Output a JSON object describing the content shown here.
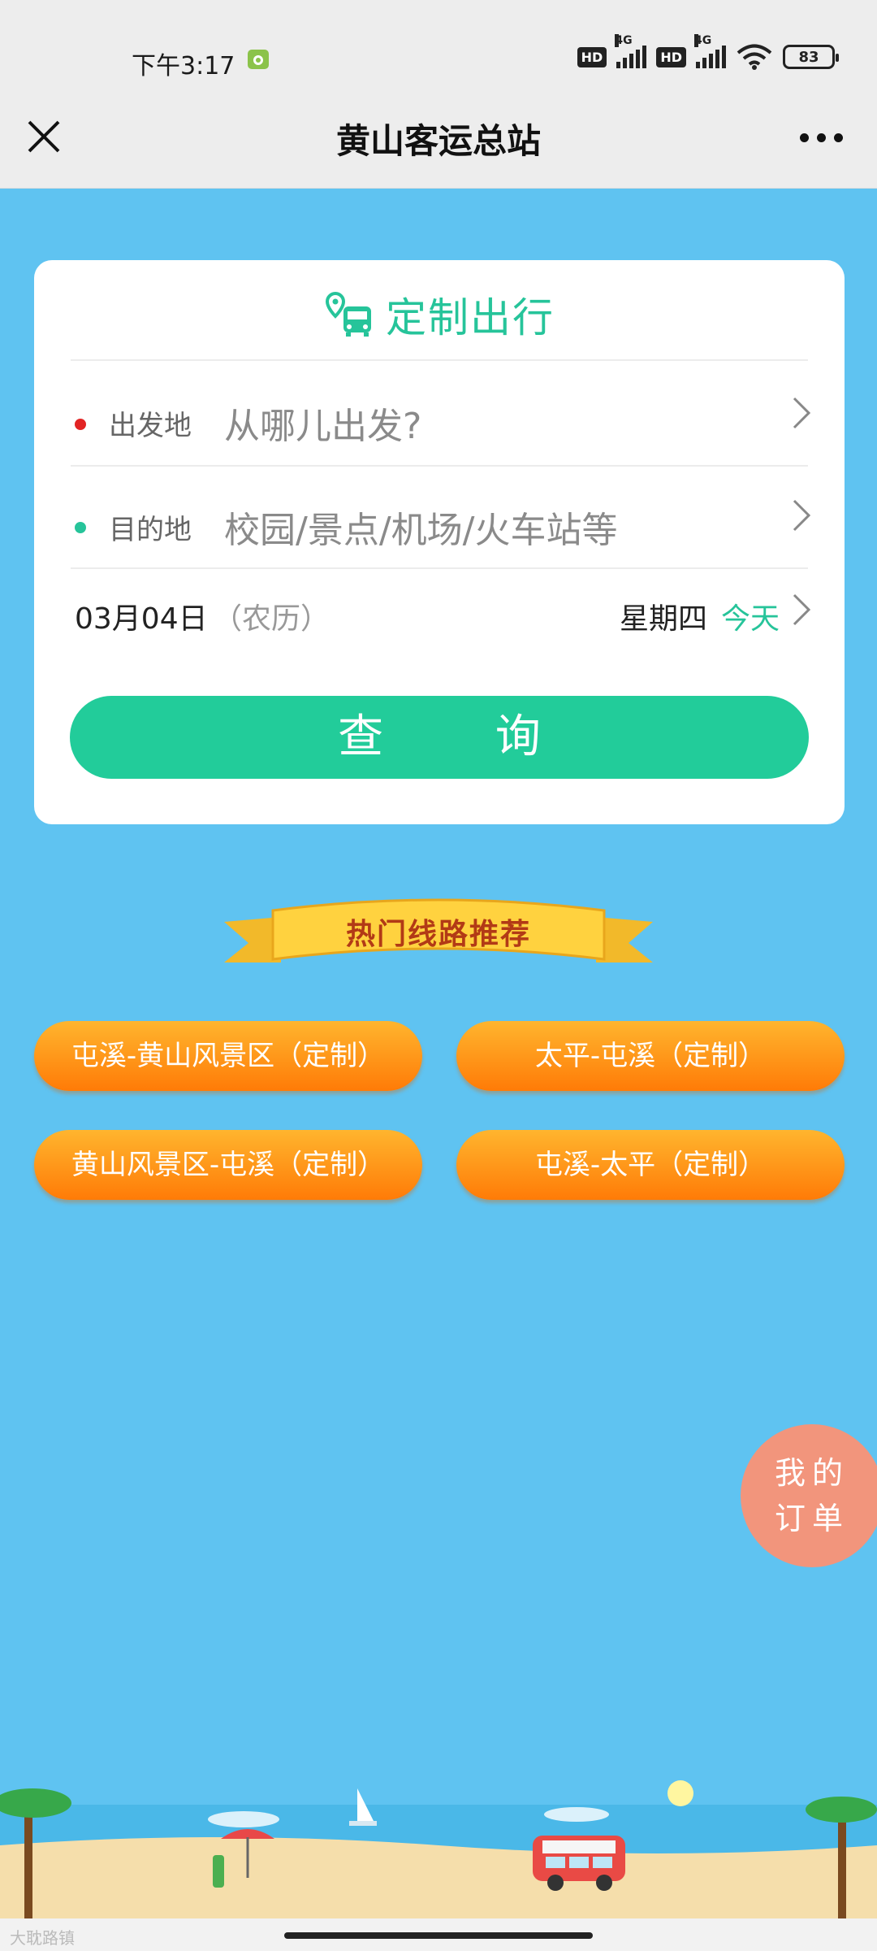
{
  "status_bar": {
    "time": "下午3:17",
    "hd1": "HD",
    "net1": "4G",
    "hd2": "HD",
    "net2": "4G",
    "battery": "83"
  },
  "nav": {
    "title": "黄山客运总站",
    "close_icon": "close-icon",
    "more_icon": "more-icon"
  },
  "card": {
    "heading": "定制出行",
    "from_label": "出发地",
    "from_placeholder": "从哪儿出发?",
    "to_label": "目的地",
    "to_placeholder": "校园/景点/机场/火车站等",
    "date": "03月04日",
    "lunar": "（农历）",
    "weekday": "星期四",
    "today": "今天",
    "query_button": "查 询"
  },
  "hot_routes": {
    "banner": "热门线路推荐",
    "items": [
      "屯溪-黄山风景区（定制）",
      "太平-屯溪（定制）",
      "黄山风景区-屯溪（定制）",
      "屯溪-太平（定制）"
    ]
  },
  "my_order": {
    "line1": "我的",
    "line2": "订单"
  },
  "watermark": "大耽路镇",
  "colors": {
    "accent": "#26c49a",
    "background": "#5fc3f1",
    "route_orange": "#ff8a10",
    "order_button": "#f2957c",
    "from_dot": "#e22424",
    "to_dot": "#26c49a"
  }
}
